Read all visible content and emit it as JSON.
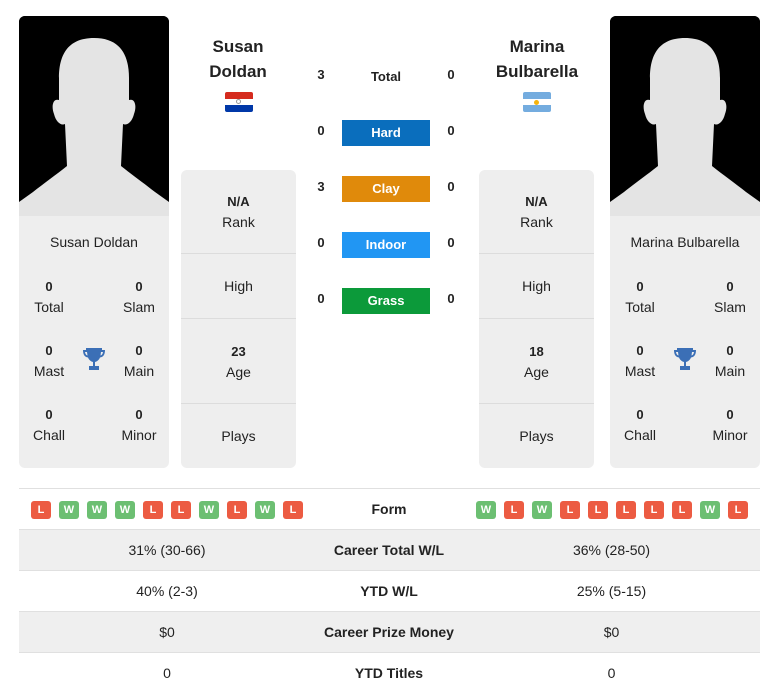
{
  "player1": {
    "name_line1": "Susan",
    "name_line2": "Doldan",
    "full_name": "Susan Doldan",
    "flag": "paraguay-flag",
    "flag_colors": [
      "#d52b1e",
      "#ffffff",
      "#0038a8"
    ],
    "titles": {
      "total": {
        "value": "0",
        "label": "Total"
      },
      "slam": {
        "value": "0",
        "label": "Slam"
      },
      "mast": {
        "value": "0",
        "label": "Mast"
      },
      "main": {
        "value": "0",
        "label": "Main"
      },
      "chall": {
        "value": "0",
        "label": "Chall"
      },
      "minor": {
        "value": "0",
        "label": "Minor"
      }
    },
    "rank": {
      "value": "N/A",
      "label": "Rank"
    },
    "high": {
      "label": "High"
    },
    "age": {
      "value": "23",
      "label": "Age"
    },
    "plays": {
      "label": "Plays"
    },
    "form": [
      "L",
      "W",
      "W",
      "W",
      "L",
      "L",
      "W",
      "L",
      "W",
      "L"
    ]
  },
  "player2": {
    "name_line1": "Marina",
    "name_line2": "Bulbarella",
    "full_name": "Marina Bulbarella",
    "flag": "argentina-flag",
    "flag_colors": [
      "#74acdf",
      "#ffffff",
      "#74acdf"
    ],
    "titles": {
      "total": {
        "value": "0",
        "label": "Total"
      },
      "slam": {
        "value": "0",
        "label": "Slam"
      },
      "mast": {
        "value": "0",
        "label": "Mast"
      },
      "main": {
        "value": "0",
        "label": "Main"
      },
      "chall": {
        "value": "0",
        "label": "Chall"
      },
      "minor": {
        "value": "0",
        "label": "Minor"
      }
    },
    "rank": {
      "value": "N/A",
      "label": "Rank"
    },
    "high": {
      "label": "High"
    },
    "age": {
      "value": "18",
      "label": "Age"
    },
    "plays": {
      "label": "Plays"
    },
    "form": [
      "W",
      "L",
      "W",
      "L",
      "L",
      "L",
      "L",
      "L",
      "W",
      "L"
    ]
  },
  "h2h": {
    "total": {
      "label": "Total",
      "p1": "3",
      "p2": "0"
    },
    "surfaces": [
      {
        "label": "Hard",
        "p1": "0",
        "p2": "0",
        "color": "#0a6ebd"
      },
      {
        "label": "Clay",
        "p1": "3",
        "p2": "0",
        "color": "#e08a0b"
      },
      {
        "label": "Indoor",
        "p1": "0",
        "p2": "0",
        "color": "#2196f3"
      },
      {
        "label": "Grass",
        "p1": "0",
        "p2": "0",
        "color": "#0c9a3a"
      }
    ]
  },
  "stats": {
    "form_label": "Form",
    "rows": [
      {
        "label": "Career Total W/L",
        "p1": "31% (30-66)",
        "p2": "36% (28-50)"
      },
      {
        "label": "YTD W/L",
        "p1": "40% (2-3)",
        "p2": "25% (5-15)"
      },
      {
        "label": "Career Prize Money",
        "p1": "$0",
        "p2": "$0"
      },
      {
        "label": "YTD Titles",
        "p1": "0",
        "p2": "0"
      }
    ]
  }
}
